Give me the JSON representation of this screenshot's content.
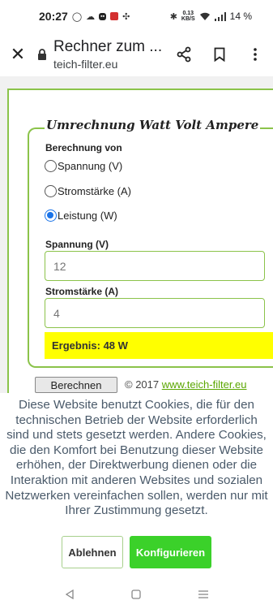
{
  "status_bar": {
    "time": "20:27",
    "net_speed": "0.13",
    "net_unit": "KB/S",
    "battery": "14 %"
  },
  "toolbar": {
    "title": "Rechner zum ...",
    "url": "teich-filter.eu"
  },
  "calculator": {
    "legend": "Umrechnung Watt Volt Ampere",
    "calc_label": "Berechnung von",
    "radio_options": [
      "Spannung (V)",
      "Stromstärke (A)",
      "Leistung (W)"
    ],
    "selected": "Leistung (W)",
    "voltage_label": "Spannung (V)",
    "voltage_placeholder": "12",
    "current_label": "Stromstärke (A)",
    "current_placeholder": "4",
    "result": "Ergebnis: 48 W",
    "calc_button": "Berechnen",
    "copyright": "© 2017",
    "copyright_link": "www.teich-filter.eu"
  },
  "cookie": {
    "text": "Diese Website benutzt Cookies, die für den technischen Betrieb der Website erforderlich sind und stets gesetzt werden. Andere Cookies, die den Komfort bei Benutzung dieser Website erhöhen, der Direktwerbung dienen oder die Interaktion mit anderen Websites und sozialen Netzwerken vereinfachen sollen, werden nur mit Ihrer Zustimmung gesetzt.",
    "reject_label": "Ablehnen",
    "configure_label": "Konfigurieren"
  },
  "colors": {
    "accent_green": "#8bc34a",
    "result_bg": "#ffff00",
    "configure_bg": "#3bd12a",
    "radio_blue": "#1a73e8"
  }
}
